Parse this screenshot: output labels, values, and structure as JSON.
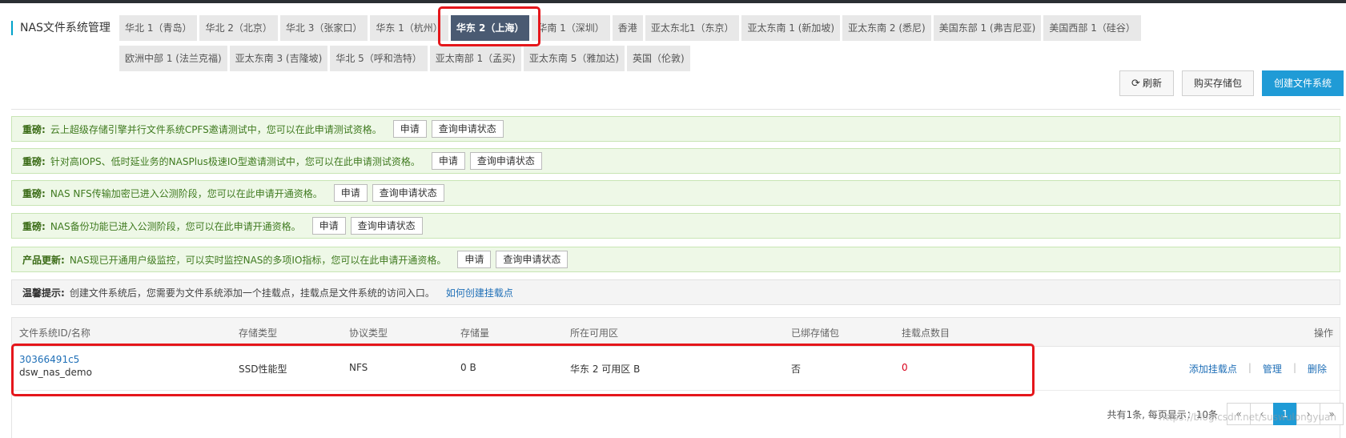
{
  "page_title": "NAS文件系统管理",
  "regions_row1": [
    "华北 1（青岛）",
    "华北 2（北京）",
    "华北 3（张家口）",
    "华东 1（杭州）",
    "华东 2（上海）",
    "华南 1（深圳）",
    "香港",
    "亚太东北1（东京）",
    "亚太东南 1 (新加坡)",
    "亚太东南 2 (悉尼)",
    "美国东部 1 (弗吉尼亚)",
    "美国西部 1（硅谷）"
  ],
  "regions_row2": [
    "欧洲中部 1 (法兰克福)",
    "亚太东南 3 (吉隆坡)",
    "华北 5（呼和浩特）",
    "亚太南部 1（孟买)",
    "亚太东南 5（雅加达)",
    "英国（伦敦)"
  ],
  "active_region": "华东 2（上海）",
  "toolbar": {
    "refresh": "刷新",
    "buy_package": "购买存储包",
    "create_fs": "创建文件系统"
  },
  "notices": [
    {
      "tag": "重磅:",
      "text": "云上超级存储引擎并行文件系统CPFS邀请测试中，您可以在此申请测试资格。",
      "apply": "申请",
      "query": "查询申请状态"
    },
    {
      "tag": "重磅:",
      "text": "针对高IOPS、低时延业务的NASPlus极速IO型邀请测试中，您可以在此申请测试资格。",
      "apply": "申请",
      "query": "查询申请状态"
    },
    {
      "tag": "重磅:",
      "text": "NAS NFS传输加密已进入公测阶段，您可以在此申请开通资格。",
      "apply": "申请",
      "query": "查询申请状态"
    },
    {
      "tag": "重磅:",
      "text": "NAS备份功能已进入公测阶段，您可以在此申请开通资格。",
      "apply": "申请",
      "query": "查询申请状态"
    },
    {
      "tag": "产品更新:",
      "text": "NAS现已开通用户级监控，可以实时监控NAS的多项IO指标，您可以在此申请开通资格。",
      "apply": "申请",
      "query": "查询申请状态"
    }
  ],
  "tip": {
    "tag": "温馨提示:",
    "text": "创建文件系统后，您需要为文件系统添加一个挂载点，挂载点是文件系统的访问入口。",
    "link": "如何创建挂载点"
  },
  "table": {
    "headers": [
      "文件系统ID/名称",
      "存储类型",
      "协议类型",
      "存储量",
      "所在可用区",
      "已绑存储包",
      "挂载点数目",
      "操作"
    ],
    "rows": [
      {
        "id": "30366491c5",
        "name": "dsw_nas_demo",
        "storage_type": "SSD性能型",
        "protocol": "NFS",
        "capacity": "0 B",
        "zone": "华东 2 可用区 B",
        "bound_package": "否",
        "mount_count": "0",
        "actions": [
          "添加挂载点",
          "管理",
          "删除"
        ]
      }
    ]
  },
  "pagination": {
    "summary": "共有1条, 每页显示：10条",
    "first": "«",
    "prev": "‹",
    "current": "1",
    "next": "›",
    "last": "»"
  },
  "watermark": "https://blog.csdn.net/suswulongyuan",
  "colors": {
    "accent": "#1f9bd6",
    "highlight": "#e5161b",
    "active_tab": "#4a5a72",
    "notice_bg": "#eef8e7",
    "danger": "#d9001b"
  }
}
